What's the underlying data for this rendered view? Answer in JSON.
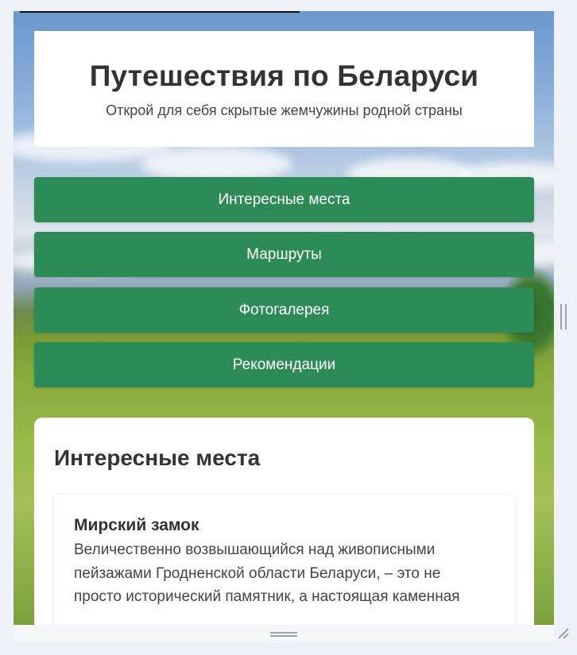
{
  "header": {
    "title": "Путешествия по Беларуси",
    "subtitle": "Открой для себя скрытые жемчужины родной страны"
  },
  "nav": {
    "items": [
      "Интересные места",
      "Маршруты",
      "Фотогалерея",
      "Рекомендации"
    ]
  },
  "section": {
    "title": "Интересные места",
    "place": {
      "name": "Мирский замок",
      "line1": "Величественно возвышающийся над живописными",
      "line2": "пейзажами Гродненской области Беларуси, – это не",
      "line3": "просто исторический памятник, а настоящая каменная"
    }
  },
  "icons": [
    "vertical-resize-handle-icon",
    "horizontal-resize-handle-icon",
    "resize-corner-icon"
  ],
  "colors": {
    "nav_button": "#2e8b57",
    "background": "#eef1f8"
  }
}
